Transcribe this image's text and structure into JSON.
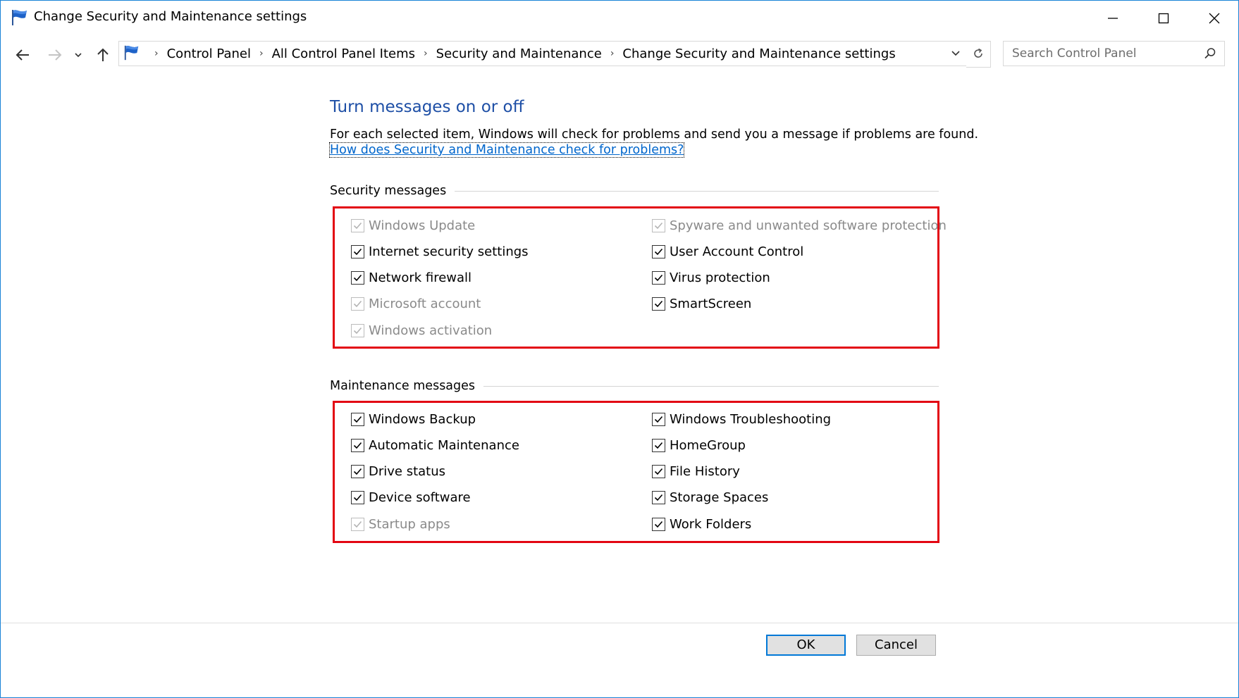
{
  "window": {
    "title": "Change Security and Maintenance settings"
  },
  "navigation": {
    "breadcrumbs": [
      "Control Panel",
      "All Control Panel Items",
      "Security and Maintenance",
      "Change Security and Maintenance settings"
    ],
    "search_placeholder": "Search Control Panel"
  },
  "main": {
    "heading": "Turn messages on or off",
    "description": "For each selected item, Windows will check for problems and send you a message if problems are found.",
    "help_link": "How does Security and Maintenance check for problems?"
  },
  "security": {
    "label": "Security messages",
    "left": [
      {
        "label": "Windows Update",
        "checked": true,
        "enabled": false
      },
      {
        "label": "Internet security settings",
        "checked": true,
        "enabled": true
      },
      {
        "label": "Network firewall",
        "checked": true,
        "enabled": true
      },
      {
        "label": "Microsoft account",
        "checked": true,
        "enabled": false
      },
      {
        "label": "Windows activation",
        "checked": true,
        "enabled": false
      }
    ],
    "right": [
      {
        "label": "Spyware and unwanted software protection",
        "checked": true,
        "enabled": false
      },
      {
        "label": "User Account Control",
        "checked": true,
        "enabled": true
      },
      {
        "label": "Virus protection",
        "checked": true,
        "enabled": true
      },
      {
        "label": "SmartScreen",
        "checked": true,
        "enabled": true
      }
    ]
  },
  "maintenance": {
    "label": "Maintenance messages",
    "left": [
      {
        "label": "Windows Backup",
        "checked": true,
        "enabled": true
      },
      {
        "label": "Automatic Maintenance",
        "checked": true,
        "enabled": true
      },
      {
        "label": "Drive status",
        "checked": true,
        "enabled": true
      },
      {
        "label": "Device software",
        "checked": true,
        "enabled": true
      },
      {
        "label": "Startup apps",
        "checked": true,
        "enabled": false
      }
    ],
    "right": [
      {
        "label": "Windows Troubleshooting",
        "checked": true,
        "enabled": true
      },
      {
        "label": "HomeGroup",
        "checked": true,
        "enabled": true
      },
      {
        "label": "File History",
        "checked": true,
        "enabled": true
      },
      {
        "label": "Storage Spaces",
        "checked": true,
        "enabled": true
      },
      {
        "label": "Work Folders",
        "checked": true,
        "enabled": true
      }
    ]
  },
  "buttons": {
    "ok": "OK",
    "cancel": "Cancel"
  },
  "colors": {
    "heading": "#1e4fa6",
    "link": "#0066cc",
    "highlight_box": "#e30613",
    "window_border": "#1883d7",
    "ok_border": "#0078d7"
  },
  "icons": {
    "title": "blue-flag-icon",
    "back": "arrow-left-icon",
    "forward": "arrow-right-icon",
    "recent": "chevron-down-icon",
    "up": "arrow-up-icon",
    "refresh": "refresh-icon",
    "search": "magnifier-icon"
  }
}
